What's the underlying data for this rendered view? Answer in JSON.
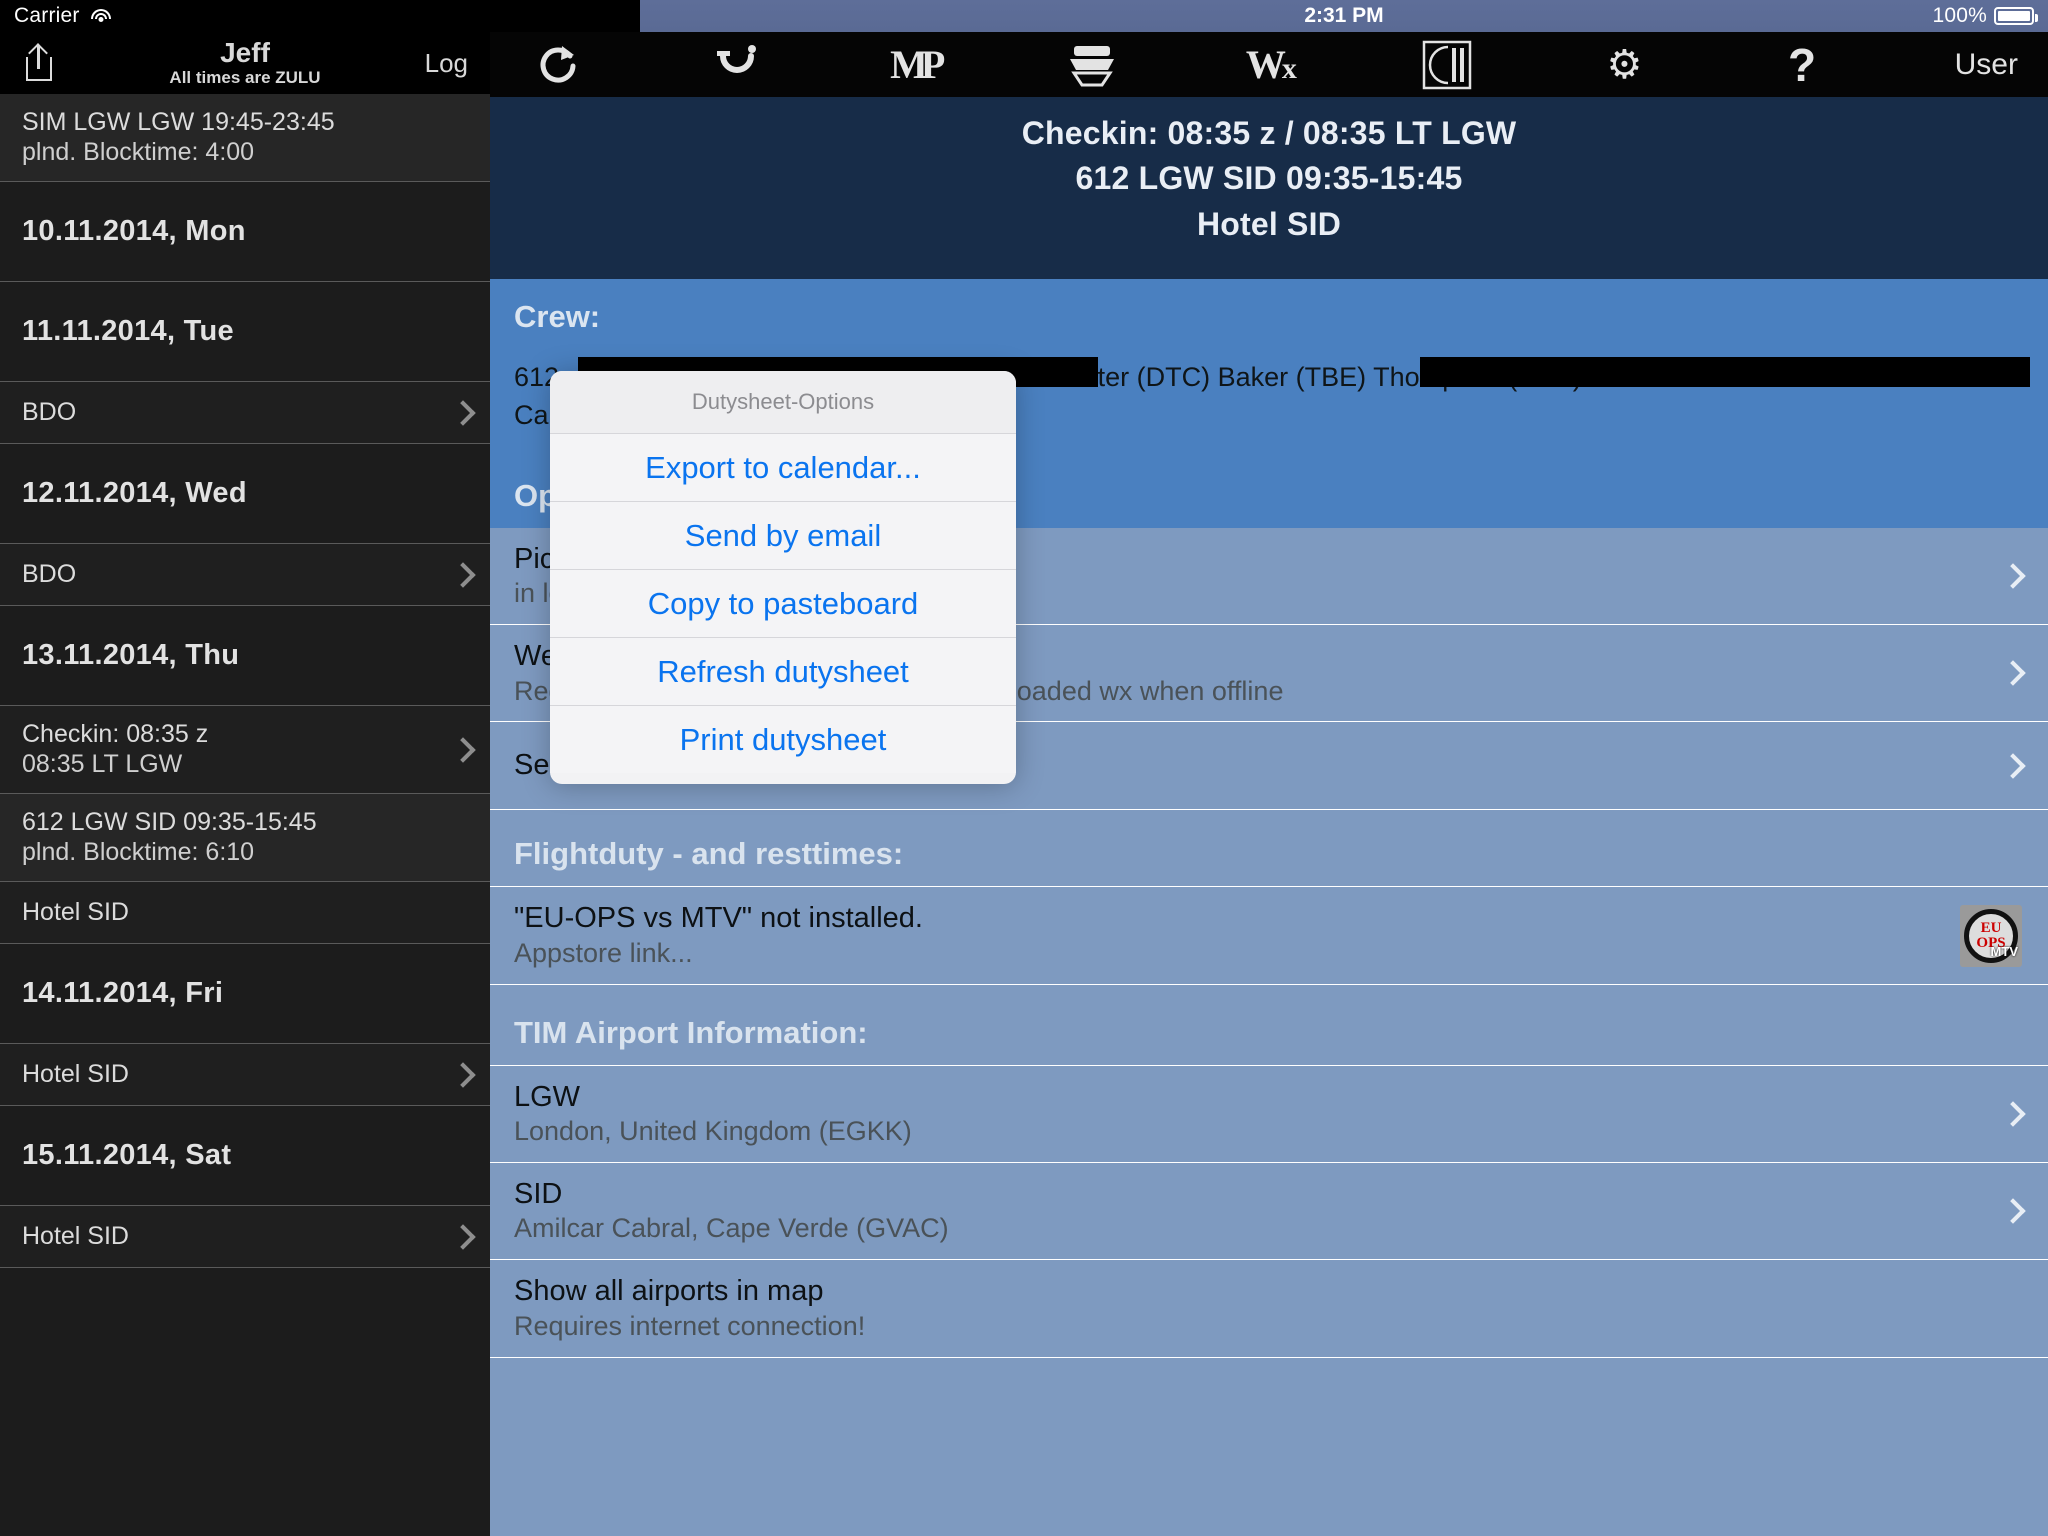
{
  "statusbar": {
    "carrier": "Carrier",
    "wifi_icon": "wifi-icon",
    "clock": "2:31 PM",
    "battery_pct": "100%",
    "battery_icon": "battery-full-icon"
  },
  "sidebar": {
    "share_icon": "share-icon",
    "title": "Jeff",
    "subtitle": "All times are ZULU",
    "log_button": "Log",
    "rows": [
      {
        "type": "entry",
        "line1": "SIM LGW LGW 19:45-23:45",
        "line2": "plnd. Blocktime: 4:00",
        "chevron": false
      },
      {
        "type": "date",
        "line1": "10.11.2014,  Mon",
        "line2": "",
        "chevron": false
      },
      {
        "type": "date",
        "line1": "11.11.2014,  Tue",
        "line2": "",
        "chevron": false
      },
      {
        "type": "entry",
        "line1": "BDO",
        "line2": "",
        "chevron": true
      },
      {
        "type": "date",
        "line1": "12.11.2014,  Wed",
        "line2": "",
        "chevron": false
      },
      {
        "type": "entry",
        "line1": "BDO",
        "line2": "",
        "chevron": true
      },
      {
        "type": "date",
        "line1": "13.11.2014,  Thu",
        "line2": "",
        "chevron": false
      },
      {
        "type": "entry",
        "line1": "Checkin: 08:35 z",
        "line2": "08:35 LT LGW",
        "chevron": true
      },
      {
        "type": "entry",
        "line1": "612 LGW SID 09:35-15:45",
        "line2": "plnd. Blocktime: 6:10",
        "chevron": false
      },
      {
        "type": "entry",
        "line1": "Hotel SID",
        "line2": "",
        "chevron": false
      },
      {
        "type": "date",
        "line1": "14.11.2014,  Fri",
        "line2": "",
        "chevron": false
      },
      {
        "type": "entry",
        "line1": "Hotel SID",
        "line2": "",
        "chevron": true
      },
      {
        "type": "date",
        "line1": "15.11.2014,  Sat",
        "line2": "",
        "chevron": false
      },
      {
        "type": "entry",
        "line1": "Hotel SID",
        "line2": "",
        "chevron": true
      }
    ]
  },
  "toolbar": {
    "items": [
      {
        "icon": "refresh-icon",
        "glyph": "↻",
        "label": ""
      },
      {
        "icon": "undo-arrow-icon",
        "glyph": "↶",
        "label": ""
      },
      {
        "icon": "mp-logo-icon",
        "glyph": "MP",
        "label": "MP"
      },
      {
        "icon": "books-stack-icon",
        "glyph": "☰",
        "label": ""
      },
      {
        "icon": "weather-wx-icon",
        "glyph": "Wx",
        "label": "Wx"
      },
      {
        "icon": "dining-plate-icon",
        "glyph": "◗",
        "label": ""
      },
      {
        "icon": "gear-icon",
        "glyph": "⚙",
        "label": ""
      },
      {
        "icon": "help-question-icon",
        "glyph": "?",
        "label": ""
      }
    ],
    "user_label": "User"
  },
  "banner": {
    "line1": "Checkin: 08:35 z / 08:35 LT LGW",
    "line2": "612 LGW SID 09:35-15:45",
    "line3": "Hotel SID"
  },
  "crew": {
    "heading": "Crew:",
    "line1": "612 :  (LEA) Browning  (RJK) Nolan  (MZL) McAllister  (DTC) Baker  (TBE) Thompson  (EHX)",
    "line2": "Carr  (MZI) Metzger",
    "redacted": true
  },
  "options": {
    "heading": "Options:",
    "rows": [
      {
        "title": "Pickup & Checkin times",
        "subtitle": "in local and zulu times",
        "chevron": true
      },
      {
        "title": "Weather & Notams",
        "subtitle": "Requires internet connection. Shows last loaded wx when offline",
        "chevron": true
      },
      {
        "title": "Send day to logbook",
        "subtitle": "",
        "chevron": true
      }
    ]
  },
  "flightduty": {
    "heading": "Flightduty - and resttimes:",
    "rows": [
      {
        "title": "\"EU-OPS vs MTV\" not installed.",
        "subtitle": "Appstore link...",
        "badge": "eu-ops-vs-mtv-badge"
      }
    ]
  },
  "airports": {
    "heading": "TIM Airport Information:",
    "rows": [
      {
        "title": "LGW",
        "subtitle": "London, United Kingdom (EGKK)",
        "chevron": true
      },
      {
        "title": "SID",
        "subtitle": "Amilcar Cabral, Cape Verde (GVAC)",
        "chevron": true
      },
      {
        "title": "Show all airports in map",
        "subtitle": "Requires internet connection!",
        "chevron": false
      }
    ]
  },
  "action_sheet": {
    "title": "Dutysheet-Options",
    "items": [
      "Export to calendar...",
      "Send by email",
      "Copy to pasteboard",
      "Refresh dutysheet",
      "Print dutysheet"
    ]
  },
  "colors": {
    "accent_blue": "#0a74ef",
    "panel_blue": "#7e9ac0",
    "section_blue": "#4a80c0",
    "banner_navy": "#172c48",
    "sidebar_dark": "#1c1c1c"
  }
}
